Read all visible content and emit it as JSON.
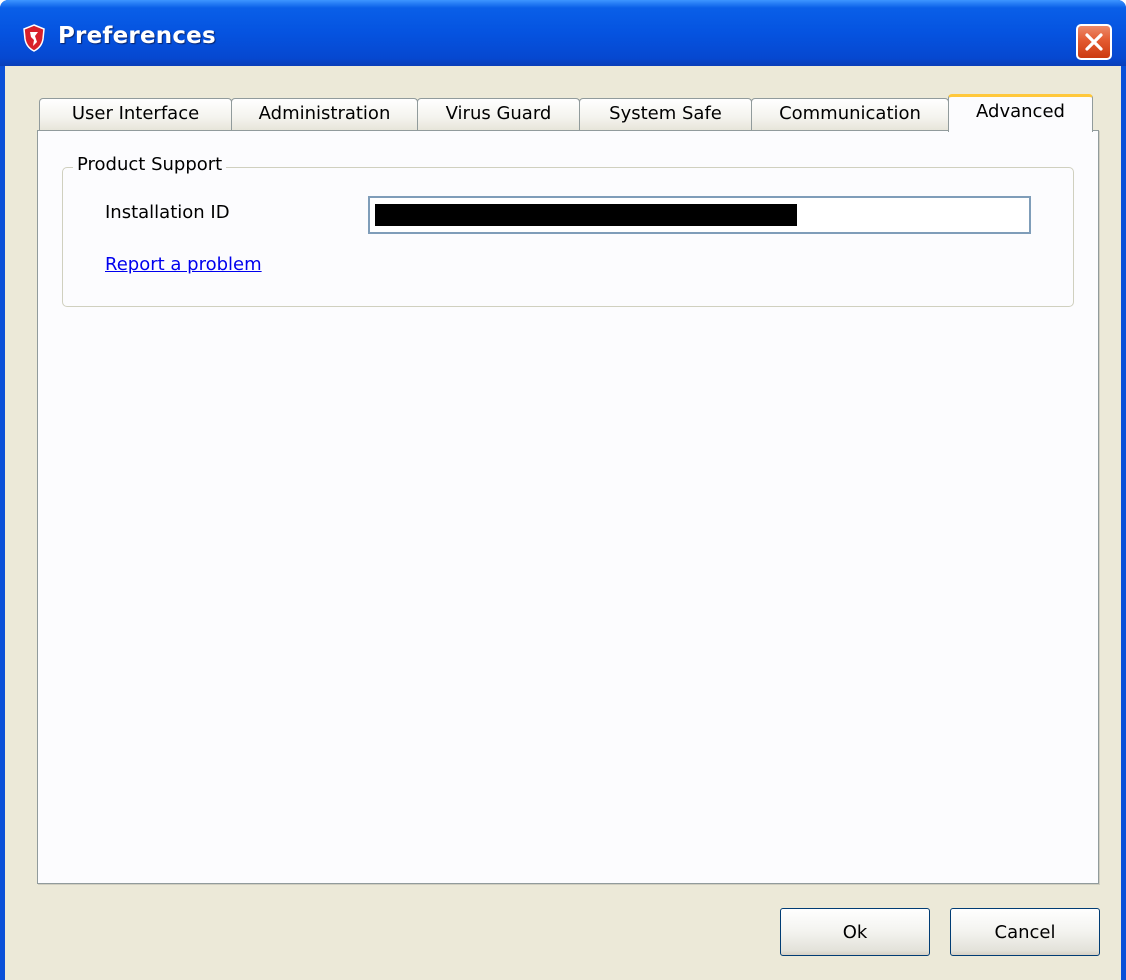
{
  "window": {
    "title": "Preferences",
    "icon": "shield-icon",
    "close_icon": "close-icon"
  },
  "tabs": [
    {
      "label": "User Interface",
      "active": false
    },
    {
      "label": "Administration",
      "active": false
    },
    {
      "label": "Virus Guard",
      "active": false
    },
    {
      "label": "System Safe",
      "active": false
    },
    {
      "label": "Communication",
      "active": false
    },
    {
      "label": "Advanced",
      "active": true
    }
  ],
  "product_support": {
    "legend": "Product Support",
    "installation_id_label": "Installation ID",
    "installation_id_value": "",
    "report_link": "Report a problem"
  },
  "buttons": {
    "ok": "Ok",
    "cancel": "Cancel"
  },
  "colors": {
    "titlebar": "#0553e0",
    "close_button": "#e35a30",
    "active_tab_accent": "#ffc83c",
    "link": "#0000ee",
    "dialog_background": "#ece9d8"
  }
}
